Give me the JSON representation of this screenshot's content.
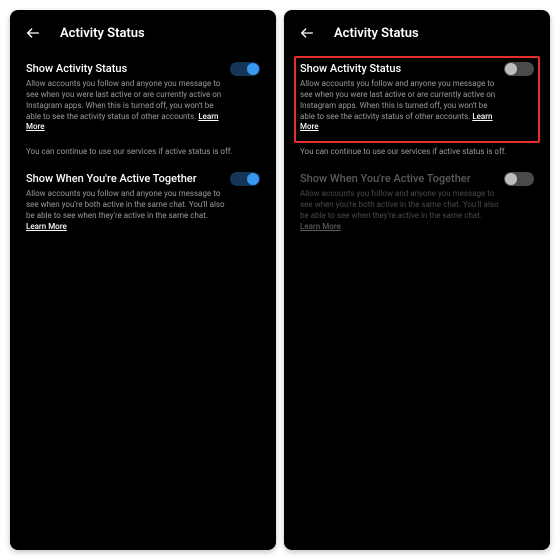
{
  "left": {
    "header": {
      "title": "Activity Status"
    },
    "setting1": {
      "title": "Show Activity Status",
      "desc": "Allow accounts you follow and anyone you message to see when you were last active or are currently active on Instagram apps. When this is turned off, you won't be able to see the activity status of other accounts.",
      "learn": "Learn More",
      "on": true
    },
    "note": "You can continue to use our services if active status is off.",
    "setting2": {
      "title": "Show When You're Active Together",
      "desc": "Allow accounts you follow and anyone you message to see when you're both active in the same chat. You'll also be able to see when they're active in the same chat.",
      "learn": "Learn More",
      "on": true
    }
  },
  "right": {
    "header": {
      "title": "Activity Status"
    },
    "setting1": {
      "title": "Show Activity Status",
      "desc": "Allow accounts you follow and anyone you message to see when you were last active or are currently active on Instagram apps. When this is turned off, you won't be able to see the activity status of other accounts.",
      "learn": "Learn More",
      "on": false,
      "highlighted": true
    },
    "note": "You can continue to use our services if active status is off.",
    "setting2": {
      "title": "Show When You're Active Together",
      "desc": "Allow accounts you follow and anyone you message to see when you're both active in the same chat. You'll also be able to see when they're active in the same chat.",
      "learn": "Learn More",
      "on": false,
      "dimmed": true
    }
  }
}
